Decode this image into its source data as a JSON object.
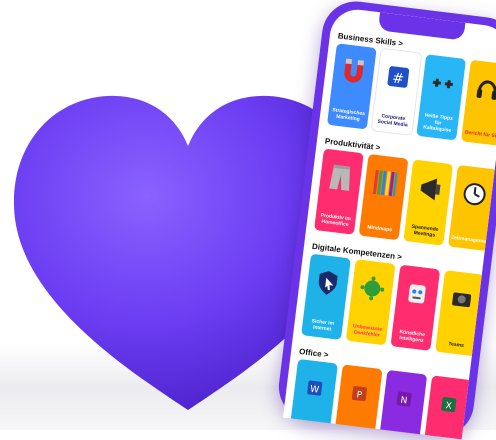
{
  "colors": {
    "brand": "#6a33e8",
    "heart": "#6b3cf2"
  },
  "sections": [
    {
      "title": "Business Skills >",
      "cards": [
        {
          "label": "Strategisches Marketing",
          "bg": "#3d8bff",
          "fg": "#ffffff",
          "icon": "magnet-icon"
        },
        {
          "label": "Corporate Social Media",
          "bg": "#ffffff",
          "fg": "#1a1a7a",
          "icon": "hashtag-icon"
        },
        {
          "label": "Heiße Tipps für Kaltakquise",
          "bg": "#29b6f6",
          "fg": "#ffffff",
          "icon": "plus-plus-icon"
        },
        {
          "label": "Bericht für Sie",
          "bg": "#ffc400",
          "fg": "#d92a2a",
          "icon": "headphones-icon"
        }
      ]
    },
    {
      "title": "Produktivität >",
      "cards": [
        {
          "label": "Produktiv im Homeoffice",
          "bg": "#ff2d6f",
          "fg": "#ffffff",
          "icon": "sweatpants-icon"
        },
        {
          "label": "Mindmaps",
          "bg": "#ff7a00",
          "fg": "#ffffff",
          "icon": "pencils-icon"
        },
        {
          "label": "Spannende Meetings",
          "bg": "#ffd200",
          "fg": "#1a1a1a",
          "icon": "megaphone-icon"
        },
        {
          "label": "Zeitmanagement",
          "bg": "#ffc400",
          "fg": "#ffffff",
          "icon": "clock-icon"
        }
      ]
    },
    {
      "title": "Digitale Kompetenzen >",
      "cards": [
        {
          "label": "Sicher im Internet",
          "bg": "#1fb2e8",
          "fg": "#ffffff",
          "icon": "shield-cursor-icon"
        },
        {
          "label": "Unbewusste Denkfehler",
          "bg": "#ffd200",
          "fg": "#ff2d6f",
          "icon": "virus-icon"
        },
        {
          "label": "Künstliche Intelligenz",
          "bg": "#ff2d6f",
          "fg": "#ffffff",
          "icon": "robot-icon"
        },
        {
          "label": "Teams",
          "bg": "#ffd200",
          "fg": "#1a1a1a",
          "icon": "camera-icon"
        }
      ]
    },
    {
      "title": "Office >",
      "cards": [
        {
          "label": "",
          "bg": "#1fb2e8",
          "fg": "#ffffff",
          "icon": "word-icon"
        },
        {
          "label": "",
          "bg": "#ff7a00",
          "fg": "#ffffff",
          "icon": "powerpoint-icon"
        },
        {
          "label": "",
          "bg": "#8a2be2",
          "fg": "#ffffff",
          "icon": "onenote-icon"
        },
        {
          "label": "",
          "bg": "#ff2d6f",
          "fg": "#ffffff",
          "icon": "excel-icon"
        }
      ]
    }
  ]
}
